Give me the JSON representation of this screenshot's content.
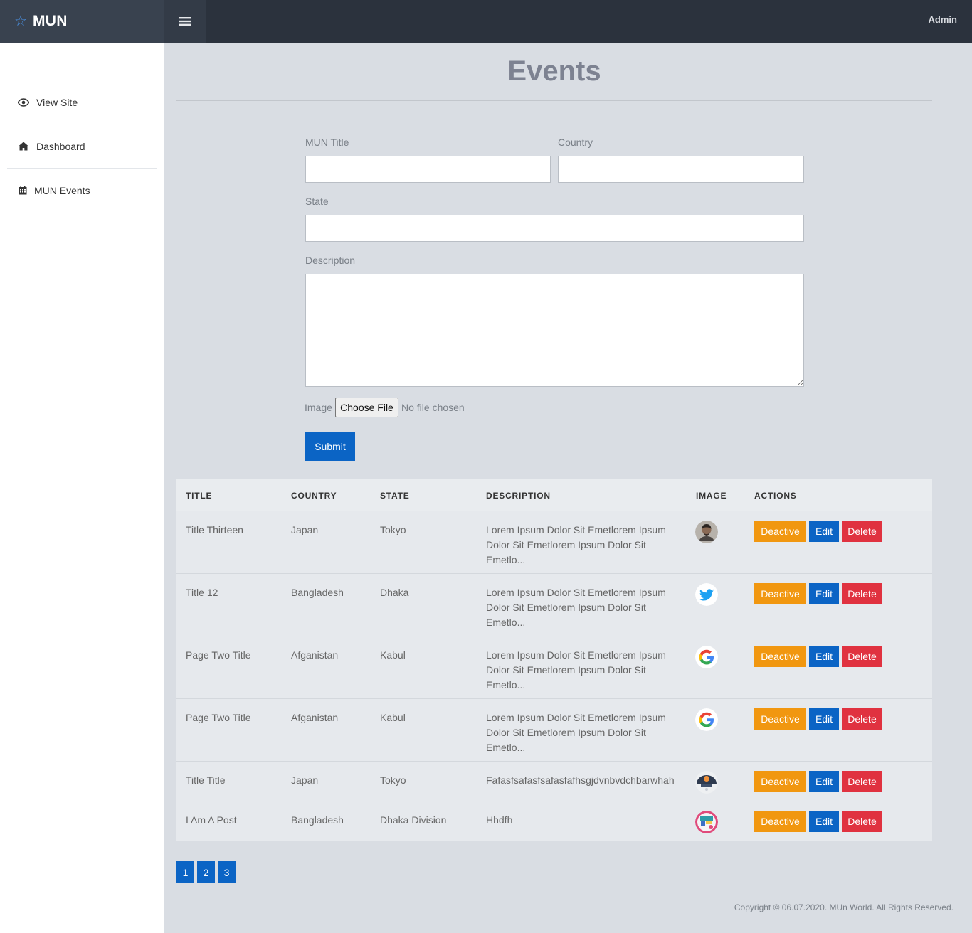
{
  "brand": {
    "name": "MUN",
    "icon": "star-icon"
  },
  "header": {
    "user": "Admin",
    "menu_icon": "bars-icon"
  },
  "sidebar": {
    "items": [
      {
        "label": "View Site",
        "icon": "eye-icon"
      },
      {
        "label": "Dashboard",
        "icon": "home-icon"
      },
      {
        "label": "MUN Events",
        "icon": "calendar-icon"
      }
    ]
  },
  "page": {
    "title": "Events"
  },
  "form": {
    "mun_title_label": "MUN Title",
    "mun_title_value": "",
    "country_label": "Country",
    "country_value": "",
    "state_label": "State",
    "state_value": "",
    "description_label": "Description",
    "description_value": "",
    "image_label": "Image",
    "choose_file": "Choose File",
    "no_file": "No file chosen",
    "submit": "Submit"
  },
  "table": {
    "headers": [
      "TITLE",
      "COUNTRY",
      "STATE",
      "DESCRIPTION",
      "IMAGE",
      "ACTIONS"
    ],
    "action_labels": {
      "deactive": "Deactive",
      "edit": "Edit",
      "delete": "Delete"
    },
    "rows": [
      {
        "title": "Title Thirteen",
        "country": "Japan",
        "state": "Tokyo",
        "description": "Lorem Ipsum Dolor Sit Emetlorem Ipsum Dolor Sit Emetlorem Ipsum Dolor Sit Emetlo...",
        "image": "person-avatar"
      },
      {
        "title": "Title 12",
        "country": "Bangladesh",
        "state": "Dhaka",
        "description": "Lorem Ipsum Dolor Sit Emetlorem Ipsum Dolor Sit Emetlorem Ipsum Dolor Sit Emetlo...",
        "image": "twitter-logo"
      },
      {
        "title": "Page Two Title",
        "country": "Afganistan",
        "state": "Kabul",
        "description": "Lorem Ipsum Dolor Sit Emetlorem Ipsum Dolor Sit Emetlorem Ipsum Dolor Sit Emetlo...",
        "image": "google-logo"
      },
      {
        "title": "Page Two Title",
        "country": "Afganistan",
        "state": "Kabul",
        "description": "Lorem Ipsum Dolor Sit Emetlorem Ipsum Dolor Sit Emetlorem Ipsum Dolor Sit Emetlo...",
        "image": "google-logo"
      },
      {
        "title": "Title Title",
        "country": "Japan",
        "state": "Tokyo",
        "description": "Fafasfsafasfsafasfafhsgjdvnbvdchbarwhah",
        "image": "dark-illustration"
      },
      {
        "title": "I Am A Post",
        "country": "Bangladesh",
        "state": "Dhaka Division",
        "description": "Hhdfh",
        "image": "colorful-illustration"
      }
    ]
  },
  "pagination": [
    "1",
    "2",
    "3"
  ],
  "footer": {
    "copyright": "Copyright © 06.07.2020. MUn World. All Rights Reserved."
  }
}
